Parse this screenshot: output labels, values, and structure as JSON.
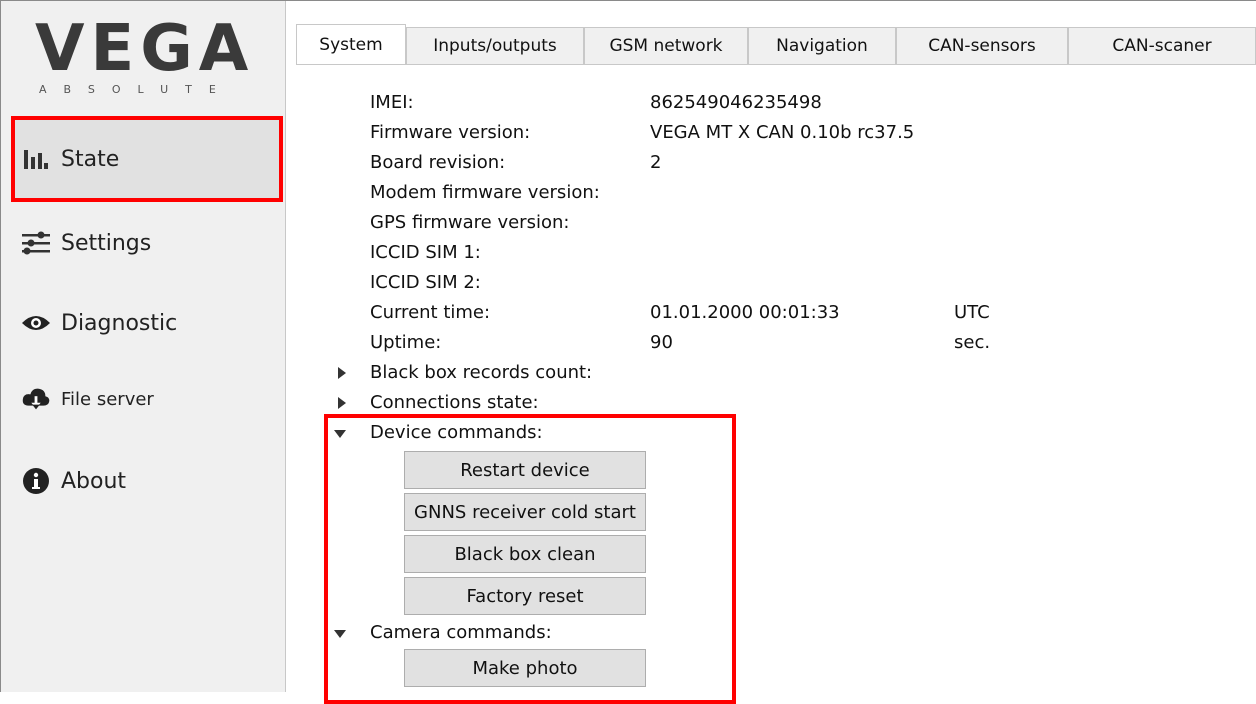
{
  "logo": {
    "word": "VEGA",
    "sub": "ABSOLUTE"
  },
  "sidebar": {
    "items": [
      {
        "label": "State",
        "icon": "bar-chart-icon"
      },
      {
        "label": "Settings",
        "icon": "sliders-icon"
      },
      {
        "label": "Diagnostic",
        "icon": "eye-icon"
      },
      {
        "label": "File server",
        "icon": "cloud-download-icon"
      },
      {
        "label": "About",
        "icon": "info-icon"
      }
    ]
  },
  "tabs": [
    "System",
    "Inputs/outputs",
    "GSM network",
    "Navigation",
    "CAN-sensors",
    "CAN-scaner"
  ],
  "system": {
    "fields": [
      {
        "label": "IMEI:",
        "value": "862549046235498",
        "unit": ""
      },
      {
        "label": "Firmware version:",
        "value": "VEGA MT X CAN 0.10b rc37.5",
        "unit": ""
      },
      {
        "label": "Board revision:",
        "value": "2",
        "unit": ""
      },
      {
        "label": "Modem firmware version:",
        "value": "",
        "unit": ""
      },
      {
        "label": "GPS firmware version:",
        "value": "",
        "unit": ""
      },
      {
        "label": "ICCID SIM 1:",
        "value": "",
        "unit": ""
      },
      {
        "label": "ICCID SIM 2:",
        "value": "",
        "unit": ""
      },
      {
        "label": "Current time:",
        "value": "01.01.2000 00:01:33",
        "unit": "UTC"
      },
      {
        "label": "Uptime:",
        "value": "90",
        "unit": "sec."
      }
    ],
    "groups": {
      "black_box": "Black box records count:",
      "connections": "Connections state:",
      "device_commands": "Device commands:",
      "camera_commands": "Camera commands:"
    },
    "device_buttons": [
      "Restart device",
      "GNNS receiver cold start",
      "Black box clean",
      "Factory reset"
    ],
    "camera_buttons": [
      "Make photo"
    ]
  },
  "colors": {
    "highlight": "#ff0000",
    "sidebar_bg": "#f0f0f0",
    "active_item_bg": "#e1e1e1"
  }
}
